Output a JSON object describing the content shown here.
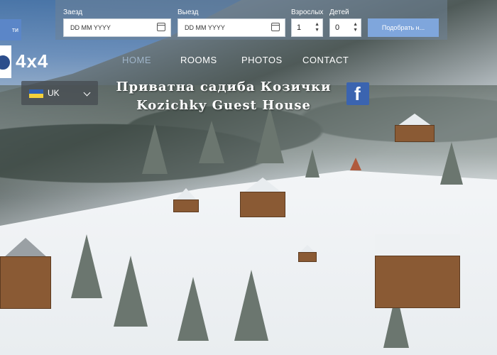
{
  "header": {
    "left_button_label": "ти",
    "search": {
      "checkin_label": "Заезд",
      "checkin_placeholder": "DD MM YYYY",
      "checkout_label": "Выезд",
      "checkout_placeholder": "DD MM YYYY",
      "adults_label": "Взрослых",
      "adults_value": "1",
      "children_label": "Детей",
      "children_value": "0",
      "search_button_label": "Подобрать н..."
    }
  },
  "logo": {
    "text": "4x4"
  },
  "nav": {
    "items": [
      {
        "label": "HOME"
      },
      {
        "label": "ROOMS"
      },
      {
        "label": "PHOTOS"
      },
      {
        "label": "CONTACT"
      }
    ]
  },
  "language": {
    "code": "UK"
  },
  "hero": {
    "title_line1": "Приватна садиба Козички",
    "title_line2": "Kozichky Guest House"
  },
  "social": {
    "facebook_letter": "f"
  },
  "colors": {
    "search_button": "#7fa6dc",
    "facebook": "#3b64b0",
    "nav_active": "#9fb4c9"
  }
}
